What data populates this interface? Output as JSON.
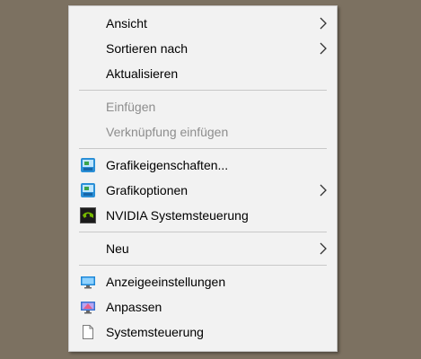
{
  "menu": {
    "items": [
      {
        "label": "Ansicht",
        "submenu": true
      },
      {
        "label": "Sortieren nach",
        "submenu": true
      },
      {
        "label": "Aktualisieren"
      },
      {
        "label": "Einfügen",
        "disabled": true
      },
      {
        "label": "Verknüpfung einfügen",
        "disabled": true
      },
      {
        "label": "Grafikeigenschaften...",
        "icon": "graphics-properties-icon"
      },
      {
        "label": "Grafikoptionen",
        "icon": "graphics-options-icon",
        "submenu": true
      },
      {
        "label": "NVIDIA Systemsteuerung",
        "icon": "nvidia-icon"
      },
      {
        "label": "Neu",
        "submenu": true
      },
      {
        "label": "Anzeigeeinstellungen",
        "icon": "display-settings-icon"
      },
      {
        "label": "Anpassen",
        "icon": "personalize-icon"
      },
      {
        "label": "Systemsteuerung",
        "icon": "document-icon"
      }
    ]
  },
  "colors": {
    "desktop": "#7c7161",
    "menu_background": "#f2f2f2",
    "disabled_text": "#8d8d8d",
    "separator": "#c8c8c8"
  }
}
